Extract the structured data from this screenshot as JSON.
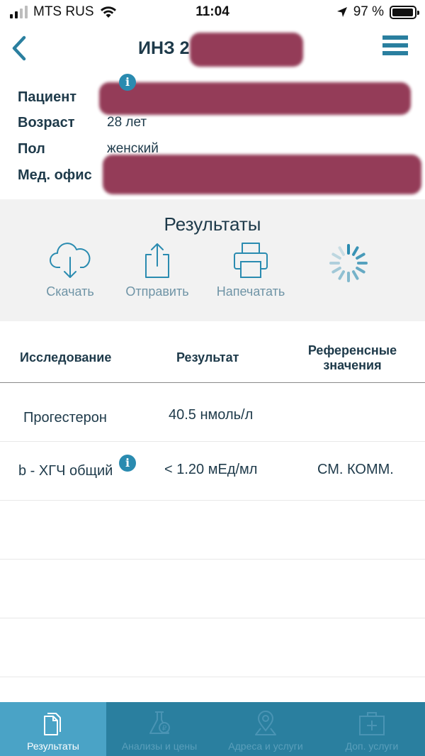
{
  "status_bar": {
    "carrier": "MTS RUS",
    "time": "11:04",
    "battery_percent": "97 %",
    "battery_level": 0.97
  },
  "header": {
    "title": "ИНЗ 2"
  },
  "patient": {
    "fields": [
      {
        "label": "Пациент",
        "value": ""
      },
      {
        "label": "Возраст",
        "value": "28 лет"
      },
      {
        "label": "Пол",
        "value": "женский"
      },
      {
        "label": "Мед. офис",
        "value": ""
      }
    ]
  },
  "results": {
    "title": "Результаты",
    "actions": [
      {
        "label": "Скачать",
        "icon": "cloud-download-icon"
      },
      {
        "label": "Отправить",
        "icon": "share-icon"
      },
      {
        "label": "Напечатать",
        "icon": "printer-icon"
      },
      {
        "label": "",
        "icon": "loading-spinner-icon"
      }
    ]
  },
  "table": {
    "headers": {
      "study": "Исследование",
      "result": "Результат",
      "reference_line1": "Референсные",
      "reference_line2": "значения"
    },
    "rows": [
      {
        "study": "Прогестерон",
        "result": "40.5 нмоль/л",
        "reference": ""
      },
      {
        "study": "b - ХГЧ общий",
        "result": "< 1.20 мЕд/мл",
        "reference": "СМ. КОММ."
      }
    ]
  },
  "tabbar": {
    "tabs": [
      {
        "label": "Результаты",
        "icon": "documents-icon",
        "active": true
      },
      {
        "label": "Анализы и цены",
        "icon": "flask-icon",
        "active": false
      },
      {
        "label": "Адреса и услуги",
        "icon": "location-pin-icon",
        "active": false
      },
      {
        "label": "Доп. услуги",
        "icon": "first-aid-kit-icon",
        "active": false
      }
    ]
  },
  "colors": {
    "accent": "#2a7f9f",
    "accent_active": "#4aa3c6",
    "text": "#1e3a4a",
    "redaction": "#8b2c4a"
  }
}
